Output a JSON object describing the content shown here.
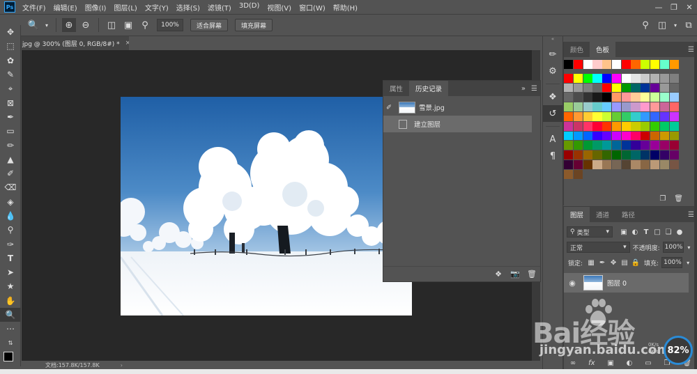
{
  "app": {
    "logo": "Ps"
  },
  "menu": [
    "文件(F)",
    "编辑(E)",
    "图像(I)",
    "图层(L)",
    "文字(Y)",
    "选择(S)",
    "滤镜(T)",
    "3D(D)",
    "视图(V)",
    "窗口(W)",
    "帮助(H)"
  ],
  "window_controls": {
    "minimize": "—",
    "restore": "❐",
    "close": "✕"
  },
  "options": {
    "zoom_value": "100%",
    "fit_screen": "适合屏幕",
    "fill_screen": "填充屏幕"
  },
  "document": {
    "tab_title": "jpg @ 300% (图层 0, RGB/8#) *",
    "close": "×",
    "status": "文档:157.8K/157.8K"
  },
  "history_panel": {
    "tabs": [
      "属性",
      "历史记录"
    ],
    "active_tab": 1,
    "snapshot_name": "雪景.jpg",
    "states": [
      "建立图层"
    ]
  },
  "swatches_panel": {
    "tabs": [
      "颜色",
      "色板"
    ],
    "active_tab": 1,
    "rows": [
      [
        "#000000",
        "#ff0000",
        "#ffffff",
        "#ffcccc",
        "#ffc38a",
        "#ffffff",
        "#ff0000",
        "#ff6600",
        "#ccff00",
        "#ffff00",
        "#66ffcc",
        "#ff9900"
      ],
      [],
      [
        "#ff0000",
        "#ffff00",
        "#00ff00",
        "#00ffff",
        "#0000ff",
        "#ff00ff",
        "#ffffff",
        "#e5e5e5",
        "#cccccc",
        "#b2b2b2",
        "#999999",
        "#7f7f7f"
      ],
      [
        "#b2b2b2",
        "#999999",
        "#7f7f7f",
        "#666666",
        "#ff0000",
        "#ffff00",
        "#009900",
        "#006666",
        "#003399",
        "#660099",
        "#999999",
        "#666666"
      ],
      [
        "#666666",
        "#4c4c4c",
        "#333333",
        "#191919",
        "#000000",
        "#ff9966",
        "#ff9999",
        "#ffcc99",
        "#ffff99",
        "#ccff99",
        "#99ffcc",
        "#99ccff"
      ],
      [
        "#99cc66",
        "#99cc99",
        "#99cccc",
        "#66cccc",
        "#66ccff",
        "#9999ff",
        "#9999cc",
        "#cc99cc",
        "#ff99cc",
        "#ff9999",
        "#cc6699",
        "#ff6666"
      ],
      [
        "#ff6600",
        "#ff9933",
        "#ffcc33",
        "#ffff33",
        "#ccff33",
        "#66cc33",
        "#33cc66",
        "#33cccc",
        "#3399ff",
        "#3366ff",
        "#6633ff",
        "#cc33ff"
      ],
      [
        "#cc3399",
        "#cc3366",
        "#ff3366",
        "#ff0033",
        "#ff3300",
        "#ff9900",
        "#ffcc00",
        "#cccc00",
        "#99cc00",
        "#33cc00",
        "#00cc66",
        "#00cc99"
      ],
      [
        "#00ccff",
        "#0099ff",
        "#0066ff",
        "#3300ff",
        "#6600ff",
        "#cc00ff",
        "#ff00cc",
        "#ff0066",
        "#cc0000",
        "#cc6600",
        "#cc9900",
        "#999900"
      ],
      [
        "#669900",
        "#339900",
        "#009933",
        "#009966",
        "#009999",
        "#006699",
        "#003399",
        "#330099",
        "#660099",
        "#990099",
        "#990066",
        "#990033"
      ],
      [
        "#990000",
        "#993300",
        "#996600",
        "#666600",
        "#336600",
        "#006600",
        "#006633",
        "#006666",
        "#003366",
        "#000066",
        "#330066",
        "#660066"
      ],
      [
        "#330033",
        "#660033",
        "#663300",
        "#ccaa88",
        "#997755",
        "#776655",
        "#554433",
        "#aa8866",
        "#886644",
        "#bb9977",
        "#998866",
        "#775544"
      ],
      [
        "#8b5a2b",
        "#6b4423"
      ]
    ]
  },
  "icon_column": [
    "brush-preset",
    "brush-settings",
    "3d-material",
    "history",
    "character",
    "paragraph"
  ],
  "layers_panel": {
    "tabs": [
      "图层",
      "通道",
      "路径"
    ],
    "active_tab": 0,
    "filter_kind": "类型",
    "blend_mode": "正常",
    "opacity_label": "不透明度:",
    "opacity_value": "100%",
    "lock_label": "锁定:",
    "fill_label": "填充:",
    "fill_value": "100%",
    "layers": [
      {
        "name": "图层 0",
        "visible": true
      }
    ]
  },
  "watermark": {
    "brand": "Bai经验",
    "url": "jingyan.baidu.com"
  },
  "badge": {
    "value": "82%"
  },
  "net": {
    "up": "0K/s",
    "down": "0K/s"
  }
}
